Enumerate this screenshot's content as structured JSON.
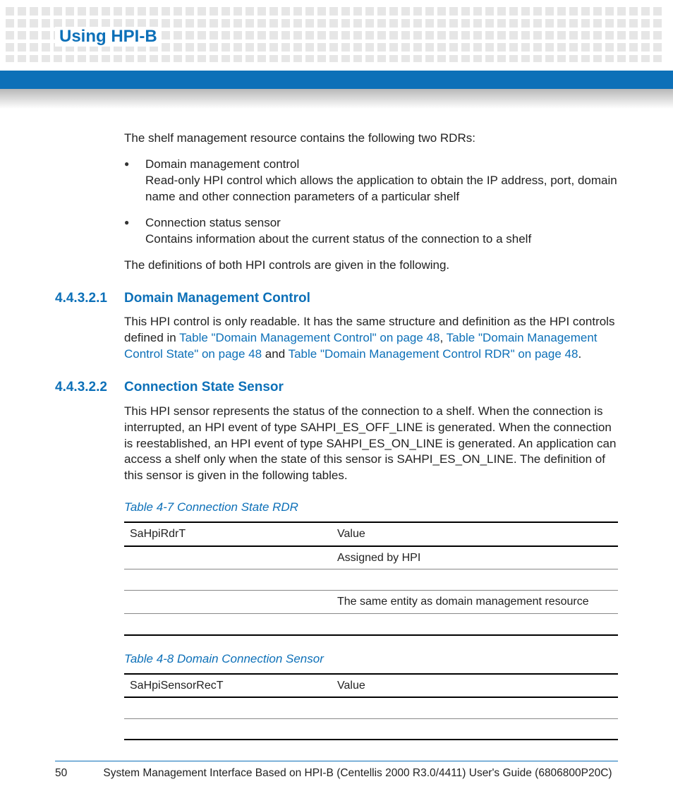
{
  "header": {
    "title": "Using HPI-B"
  },
  "intro": {
    "para1": "The shelf management resource contains the following two RDRs:",
    "bullets": [
      {
        "title": "Domain management control",
        "desc": "Read-only HPI control which allows the application to obtain the IP address, port, domain name and other connection parameters of a particular shelf"
      },
      {
        "title": "Connection status sensor",
        "desc": "Contains information about the current status of the connection to a shelf"
      }
    ],
    "para2": "The definitions of both HPI controls are given in the following."
  },
  "sections": {
    "s1": {
      "num": "4.4.3.2.1",
      "title": "Domain Management Control",
      "para_before": "This HPI control is only readable. It has the same structure and definition as the HPI controls defined in ",
      "link1": "Table \"Domain Management Control\" on page 48",
      "sep1": ", ",
      "link2": "Table \"Domain Management Control State\" on page 48",
      "sep2": " and ",
      "link3": "Table \"Domain Management Control RDR\" on page 48",
      "tail": "."
    },
    "s2": {
      "num": "4.4.3.2.2",
      "title": "Connection State Sensor",
      "para": "This HPI sensor represents the status of the connection to a shelf. When the connection is interrupted, an HPI event of type SAHPI_ES_OFF_LINE is generated. When the connection is reestablished, an HPI event of type SAHPI_ES_ON_LINE is generated. An application can access a shelf only when the state of this sensor is SAHPI_ES_ON_LINE. The definition of this sensor is given in the following tables."
    }
  },
  "tables": {
    "t1": {
      "caption": "Table 4-7 Connection State RDR",
      "headers": [
        "SaHpiRdrT",
        "Value"
      ],
      "rows": [
        [
          "",
          "Assigned by HPI"
        ],
        [
          "",
          ""
        ],
        [
          "",
          "The same entity as domain management resource"
        ],
        [
          "",
          ""
        ]
      ]
    },
    "t2": {
      "caption": "Table 4-8 Domain Connection Sensor",
      "headers": [
        "SaHpiSensorRecT",
        "Value"
      ],
      "rows": [
        [
          "",
          ""
        ],
        [
          "",
          ""
        ]
      ]
    }
  },
  "footer": {
    "page": "50",
    "text": "System Management Interface Based on HPI-B (Centellis 2000 R3.0/4411) User's Guide (6806800P20C)"
  }
}
